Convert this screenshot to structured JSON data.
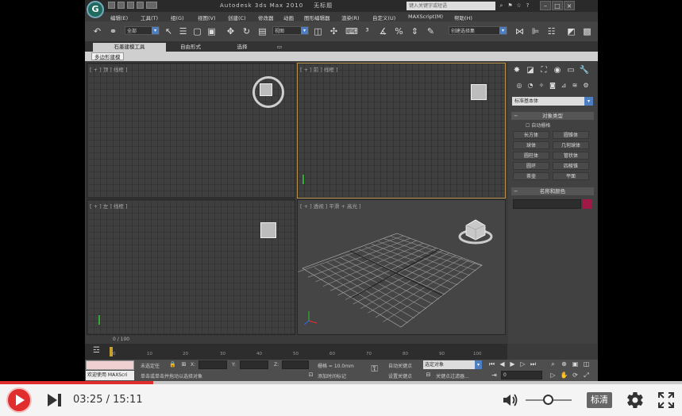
{
  "window": {
    "title": "Autodesk 3ds Max 2010",
    "file": "无标题",
    "search_placeholder": "键入关键字或短语",
    "logo": "G"
  },
  "menus": [
    "编辑(E)",
    "工具(T)",
    "组(G)",
    "视图(V)",
    "创建(C)",
    "修改器",
    "动画",
    "图形编辑器",
    "渲染(R)",
    "自定义(U)",
    "MAXScript(M)",
    "帮助(H)"
  ],
  "toolbar": {
    "selection_filter": "全部",
    "reference_coord": "视图",
    "named_selection": "创建选择集"
  },
  "ribbon": {
    "tabs": [
      "石墨建模工具",
      "自由形式",
      "选择",
      "▭"
    ],
    "subtab": "多边形建模"
  },
  "viewports": {
    "top": "[ + ] 顶 ] 线框 ]",
    "front": "[ + ] 前 ] 线框 ]",
    "left": "[ + ] 左 ] 线框 ]",
    "perspective": "[ + ] 透视 ] 平滑 + 高光 ]"
  },
  "command_panel": {
    "category_dropdown": "标准基本体",
    "object_type_title": "对象类型",
    "autogrid_label": "自动栅格",
    "buttons": [
      "长方体",
      "圆锥体",
      "球体",
      "几何球体",
      "圆柱体",
      "管状体",
      "圆环",
      "四棱锥",
      "茶壶",
      "平面"
    ],
    "name_color_title": "名称和颜色"
  },
  "timeline": {
    "frame_display": "0 / 100",
    "ticks": [
      "0",
      "10",
      "20",
      "30",
      "40",
      "50",
      "60",
      "70",
      "80",
      "90",
      "100"
    ]
  },
  "status_bar": {
    "welcome": "欢迎使用 MAXScri",
    "selection_status": "未选定任",
    "prompt": "单击或单击并拖动以选择对象",
    "x_label": "X:",
    "y_label": "Y:",
    "z_label": "Z:",
    "grid": "栅格 = 10.0mm",
    "add_time_tag": "添加时间标记",
    "auto_key": "自动关键点",
    "selected_dropdown": "选定对象",
    "set_key": "设置关键点",
    "key_filters": "关键点过滤器...",
    "frame_value": "0"
  },
  "player": {
    "current_time": "03:25",
    "separator": " / ",
    "total_time": "15:11",
    "progress": 0.225,
    "volume": 0.5,
    "quality_label": "标清"
  }
}
